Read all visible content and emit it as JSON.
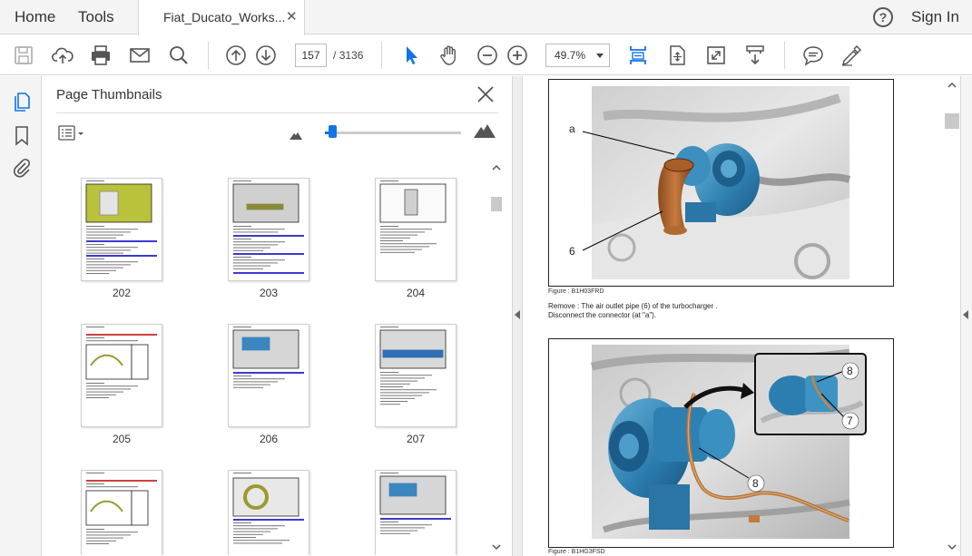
{
  "menu": {
    "home": "Home",
    "tools": "Tools",
    "sign_in": "Sign In",
    "help_glyph": "?"
  },
  "tab": {
    "title": "Fiat_Ducato_Works...",
    "close_glyph": "✕"
  },
  "toolbar": {
    "current_page": "157",
    "page_separator": "/",
    "total_pages": "3136",
    "zoom": "49.7%",
    "accent_color": "#1473e6",
    "icons": [
      "save-icon",
      "cloud-upload-icon",
      "print-icon",
      "email-icon",
      "search-icon",
      "page-up-icon",
      "page-down-icon",
      "select-cursor-icon",
      "hand-icon",
      "zoom-out-icon",
      "zoom-in-icon",
      "fit-width-icon",
      "fit-page-icon",
      "full-screen-icon",
      "scrolling-mode-icon",
      "comment-icon",
      "sign-icon"
    ]
  },
  "rail": {
    "icons": [
      "page-thumbnails-icon",
      "bookmarks-icon",
      "attachments-icon"
    ]
  },
  "thumbnail_panel": {
    "title": "Page Thumbnails",
    "thumbnail_size_fraction": 0.05,
    "pages": [
      {
        "label": "202",
        "kind": "photo-yellow"
      },
      {
        "label": "203",
        "kind": "photo-gray"
      },
      {
        "label": "204",
        "kind": "diagram"
      },
      {
        "label": "205",
        "kind": "table"
      },
      {
        "label": "206",
        "kind": "photo-blue"
      },
      {
        "label": "207",
        "kind": "photo-blue-bar"
      },
      {
        "label": "",
        "kind": "table"
      },
      {
        "label": "",
        "kind": "photo-ring"
      },
      {
        "label": "",
        "kind": "photo-blue"
      }
    ]
  },
  "document": {
    "figure1": {
      "callout_a": "a",
      "callout_6": "6",
      "caption": "Figure : B1H03FRD"
    },
    "instruction_1": "Remove : The air outlet pipe (6) of the turbocharger .",
    "instruction_2": "Disconnect the connector (at \"a\").",
    "figure2": {
      "callout_8_top": "8",
      "callout_7": "7",
      "callout_8_main": "8",
      "caption": "Figure : B1HG3FSD"
    }
  }
}
